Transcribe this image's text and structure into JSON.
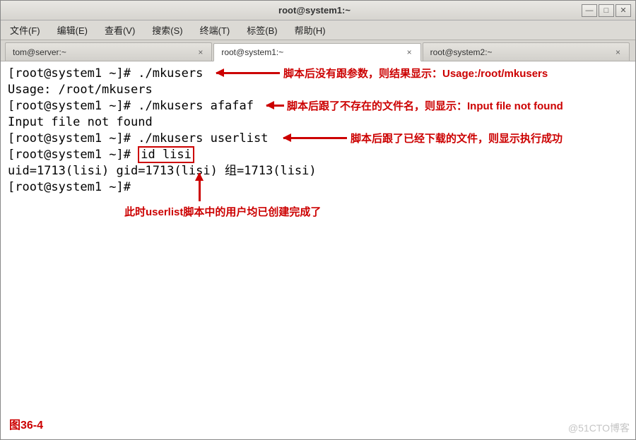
{
  "window": {
    "title": "root@system1:~"
  },
  "menu": {
    "items": [
      "文件(F)",
      "编辑(E)",
      "查看(V)",
      "搜索(S)",
      "终端(T)",
      "标签(B)",
      "帮助(H)"
    ]
  },
  "tabs": {
    "items": [
      {
        "label": "tom@server:~",
        "active": false
      },
      {
        "label": "root@system1:~",
        "active": true
      },
      {
        "label": "root@system2:~",
        "active": false
      }
    ]
  },
  "terminal": {
    "lines": [
      {
        "prompt": "[root@system1 ~]# ",
        "cmd": "./mkusers"
      },
      {
        "out": "Usage: /root/mkusers"
      },
      {
        "prompt": "[root@system1 ~]# ",
        "cmd": "./mkusers afafaf"
      },
      {
        "out": "Input file not found"
      },
      {
        "prompt": "[root@system1 ~]# ",
        "cmd": "./mkusers userlist"
      },
      {
        "prompt": "[root@system1 ~]# ",
        "cmd_boxed": "id lisi"
      },
      {
        "out": "uid=1713(lisi) gid=1713(lisi) 组=1713(lisi)"
      },
      {
        "prompt": "[root@system1 ~]# ",
        "cmd": ""
      }
    ]
  },
  "annotations": {
    "a1": "脚本后没有跟参数，则结果显示：Usage:/root/mkusers",
    "a2": "脚本后跟了不存在的文件名，则显示：Input file not found",
    "a3": "脚本后跟了已经下载的文件，则显示执行成功",
    "a4": "此时userlist脚本中的用户均已创建完成了"
  },
  "figure_label": "图36-4",
  "watermark": "@51CTO博客"
}
